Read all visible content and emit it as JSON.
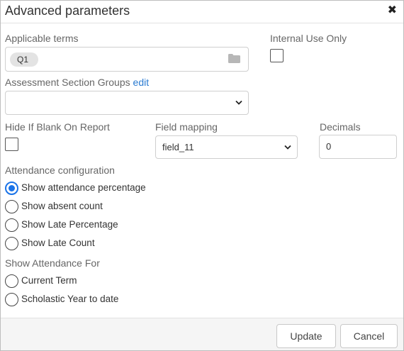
{
  "dialog": {
    "title": "Advanced parameters",
    "close_icon": "close-icon"
  },
  "applicable_terms": {
    "label": "Applicable terms",
    "chip": "Q1",
    "icon": "folder-icon"
  },
  "internal_use": {
    "label": "Internal Use Only",
    "checked": false
  },
  "assessment_groups": {
    "label": "Assessment Section Groups",
    "edit_link": "edit",
    "value": ""
  },
  "hide_blank": {
    "label": "Hide If Blank On Report",
    "checked": false
  },
  "field_mapping": {
    "label": "Field mapping",
    "value": "field_11"
  },
  "decimals": {
    "label": "Decimals",
    "value": "0"
  },
  "attendance_config": {
    "label": "Attendance configuration",
    "options": [
      {
        "label": "Show attendance percentage",
        "checked": true
      },
      {
        "label": "Show absent count",
        "checked": false
      },
      {
        "label": "Show Late Percentage",
        "checked": false
      },
      {
        "label": "Show Late Count",
        "checked": false
      }
    ]
  },
  "attendance_for": {
    "label": "Show Attendance For",
    "options": [
      {
        "label": "Current Term",
        "checked": false
      },
      {
        "label": "Scholastic Year to date",
        "checked": false
      }
    ]
  },
  "footer": {
    "update_label": "Update",
    "cancel_label": "Cancel"
  },
  "colors": {
    "accent": "#1a73e8",
    "link": "#2a7bd1",
    "label": "#666666",
    "footer_bg": "#f5f5f5"
  }
}
